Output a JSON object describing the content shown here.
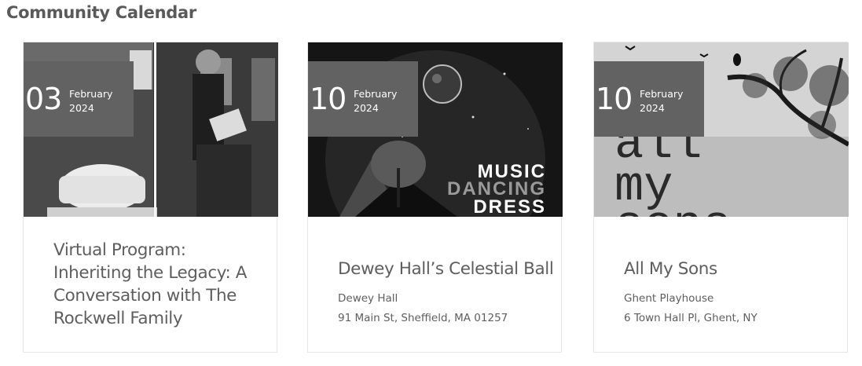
{
  "page": {
    "title": "Community Calendar"
  },
  "events": [
    {
      "day": "03",
      "month": "February",
      "year": "2024",
      "title": "Virtual Program: Inheriting the Legacy: A Conversation with The Rockwell Family",
      "venue": "",
      "address": ""
    },
    {
      "day": "10",
      "month": "February",
      "year": "2024",
      "title": "Dewey Hall’s Celestial Ball",
      "venue": "Dewey Hall",
      "address": "91 Main St, Sheffield, MA 01257",
      "poster_text": [
        "MUSIC",
        "DANCING",
        "DRESS"
      ]
    },
    {
      "day": "10",
      "month": "February",
      "year": "2024",
      "title": "All My Sons",
      "venue": "Ghent Playhouse",
      "address": "6 Town Hall Pl, Ghent, NY",
      "poster_text": [
        "all",
        "my",
        "sons"
      ]
    }
  ]
}
